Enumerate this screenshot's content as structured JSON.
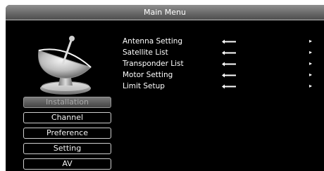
{
  "window": {
    "title": "Main Menu"
  },
  "left_menu": {
    "items": [
      {
        "label": "Installation",
        "selected": true
      },
      {
        "label": "Channel",
        "selected": false
      },
      {
        "label": "Preference",
        "selected": false
      },
      {
        "label": "Setting",
        "selected": false
      },
      {
        "label": "AV",
        "selected": false
      }
    ]
  },
  "submenu": {
    "items": [
      {
        "label": "Antenna Setting",
        "icon": "enter-arrow-icon",
        "arrow": "▸"
      },
      {
        "label": "Satellite List",
        "icon": "enter-arrow-icon",
        "arrow": "▸"
      },
      {
        "label": "Transponder List",
        "icon": "enter-arrow-icon",
        "arrow": "▸"
      },
      {
        "label": "Motor Setting",
        "icon": "enter-arrow-icon",
        "arrow": "▸"
      },
      {
        "label": "Limit Setup",
        "icon": "enter-arrow-icon",
        "arrow": "▸"
      }
    ]
  },
  "graphics": {
    "category_icon": "satellite-dish-icon"
  },
  "colors": {
    "background": "#000000",
    "text": "#ffffff",
    "title_bar": "#6d6d6d",
    "selected_item": "#5a5a5a"
  }
}
